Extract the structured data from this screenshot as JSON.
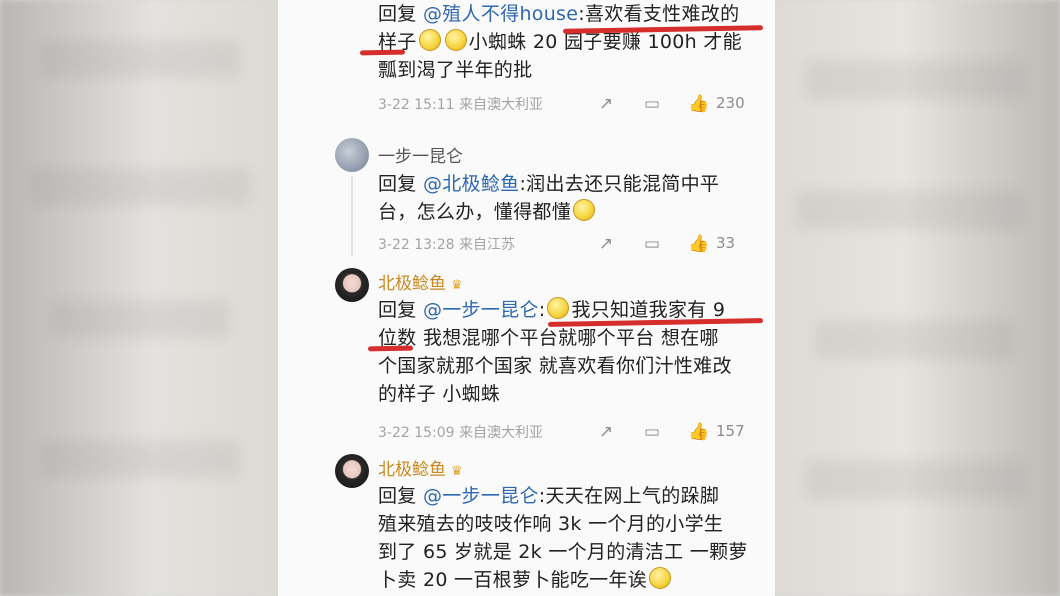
{
  "colors": {
    "mention": "#2e68ae",
    "username_gold": "#c9891e",
    "highlight": "#d62d2d",
    "meta": "#a4a4a4"
  },
  "comments": [
    {
      "reply_prefix": "回复",
      "mention": "@殖人不得house",
      "text_parts": [
        ":喜欢看支性难改的",
        "样子",
        "小蜘蛛 20 园子要赚 100h 才能",
        "瓢到渴了半年的批"
      ],
      "time": "3-22 15:11",
      "location": "来自澳大利亚",
      "likes": "230"
    },
    {
      "username": "一步一昆仑",
      "reply_prefix": "回复",
      "mention": "@北极鲶鱼",
      "text_parts": [
        ":润出去还只能混简中平",
        "台，怎么办，懂得都懂"
      ],
      "time": "3-22 13:28",
      "location": "来自江苏",
      "likes": "33"
    },
    {
      "username": "北极鲶鱼",
      "reply_prefix": "回复",
      "mention": "@一步一昆仑",
      "text_parts": [
        ":",
        "我只知道我家有 9",
        "位数",
        " 我想混哪个平台就哪个平台 想在哪",
        "个国家就那个国家 就喜欢看你们汁性难改",
        "的样子 小蜘蛛"
      ],
      "time": "3-22 15:09",
      "location": "来自澳大利亚",
      "likes": "157"
    },
    {
      "username": "北极鲶鱼",
      "reply_prefix": "回复",
      "mention": "@一步一昆仑",
      "text_parts": [
        ":天天在网上气的跺脚",
        "殖来殖去的吱吱作响 3k 一个月的小学生",
        "到了 65 岁就是 2k 一个月的清洁工 一颗萝",
        "卜卖 20 一百根萝卜能吃一年诶"
      ]
    }
  ],
  "icons": {
    "share": "share-icon",
    "reply": "comment-icon",
    "like": "thumbs-up-icon",
    "crown": "crown-icon",
    "emoji": "smile-emoji-icon"
  }
}
